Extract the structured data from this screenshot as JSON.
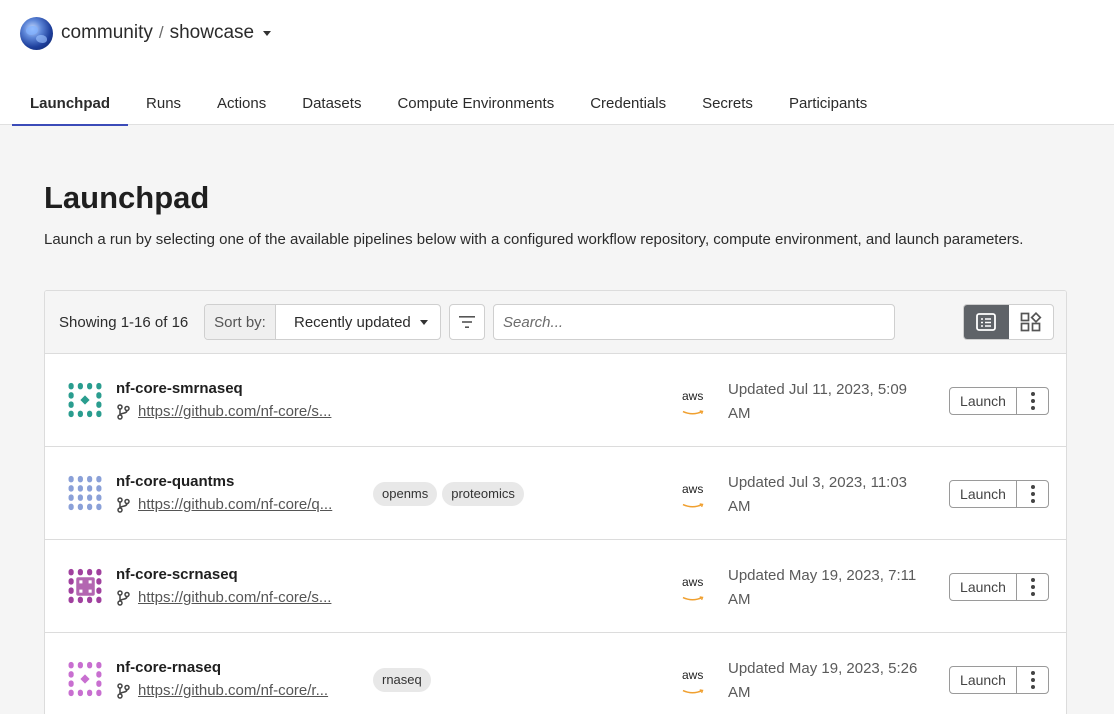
{
  "header": {
    "org": "community",
    "separator": "/",
    "workspace": "showcase",
    "avatar_icon": "globe-avatar-icon"
  },
  "tabs": [
    {
      "label": "Launchpad",
      "active": true
    },
    {
      "label": "Runs",
      "active": false
    },
    {
      "label": "Actions",
      "active": false
    },
    {
      "label": "Datasets",
      "active": false
    },
    {
      "label": "Compute Environments",
      "active": false
    },
    {
      "label": "Credentials",
      "active": false
    },
    {
      "label": "Secrets",
      "active": false
    },
    {
      "label": "Participants",
      "active": false
    }
  ],
  "page": {
    "title": "Launchpad",
    "description": "Launch a run by selecting one of the available pipelines below with a configured workflow repository, compute environment, and launch parameters."
  },
  "toolbar": {
    "showing": "Showing 1-16 of 16",
    "sort_label": "Sort by:",
    "sort_value": "Recently updated",
    "search_placeholder": "Search...",
    "active_view": "list"
  },
  "pipelines": [
    {
      "name": "nf-core-smrnaseq",
      "repo": "https://github.com/nf-core/s...",
      "tags": [],
      "platform": "aws",
      "updated_line1": "Updated Jul 11, 2023, 5:09",
      "updated_line2": "AM",
      "launch_label": "Launch",
      "icon_color": "#2a9d8f"
    },
    {
      "name": "nf-core-quantms",
      "repo": "https://github.com/nf-core/q...",
      "tags": [
        "openms",
        "proteomics"
      ],
      "platform": "aws",
      "updated_line1": "Updated Jul 3, 2023, 11:03",
      "updated_line2": "AM",
      "launch_label": "Launch",
      "icon_color": "#8aa0d8"
    },
    {
      "name": "nf-core-scrnaseq",
      "repo": "https://github.com/nf-core/s...",
      "tags": [],
      "platform": "aws",
      "updated_line1": "Updated May 19, 2023, 7:11",
      "updated_line2": "AM",
      "launch_label": "Launch",
      "icon_color": "#a0409e"
    },
    {
      "name": "nf-core-rnaseq",
      "repo": "https://github.com/nf-core/r...",
      "tags": [
        "rnaseq"
      ],
      "platform": "aws",
      "updated_line1": "Updated May 19, 2023, 5:26",
      "updated_line2": "AM",
      "launch_label": "Launch",
      "icon_color": "#c86fd0"
    }
  ]
}
